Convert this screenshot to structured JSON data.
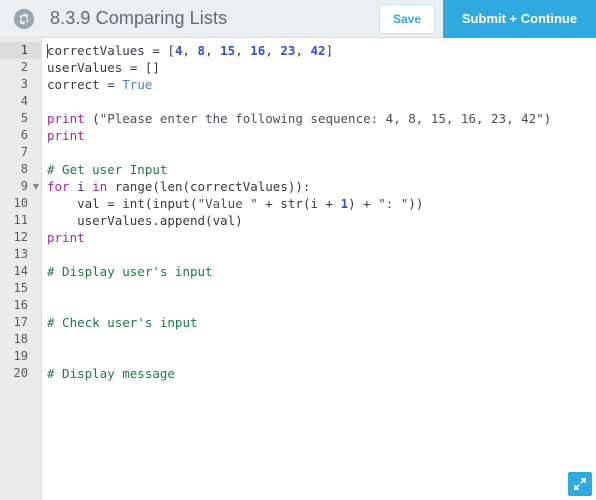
{
  "header": {
    "gear_icon": "gear-icon",
    "title": "8.3.9 Comparing Lists",
    "save_label": "Save",
    "submit_label": "Submit + Continue",
    "accent_color": "#2eaae0",
    "background_color": "#eceff1",
    "title_color": "#5f6a72"
  },
  "editor": {
    "language": "python",
    "active_line": 1,
    "cursor_line": 1,
    "cursor_column": 1,
    "total_lines": 20,
    "fold_lines": [
      9
    ],
    "gutter_color": "#ebebeb",
    "background_color": "#ffffff",
    "syntax_colors": {
      "keyword": "#a626a4",
      "number": "#2f4ed8",
      "constant": "#4a7fe0",
      "string": "#4b4f58",
      "comment": "#1d7a47",
      "plain": "#383a42"
    },
    "lines": [
      {
        "n": "1",
        "tokens": [
          {
            "t": "correctValues ",
            "c": "pln"
          },
          {
            "t": "= ",
            "c": "op"
          },
          {
            "t": "[",
            "c": "pun"
          },
          {
            "t": "4",
            "c": "num"
          },
          {
            "t": ", ",
            "c": "pun"
          },
          {
            "t": "8",
            "c": "num"
          },
          {
            "t": ", ",
            "c": "pun"
          },
          {
            "t": "15",
            "c": "num"
          },
          {
            "t": ", ",
            "c": "pun"
          },
          {
            "t": "16",
            "c": "num"
          },
          {
            "t": ", ",
            "c": "pun"
          },
          {
            "t": "23",
            "c": "num"
          },
          {
            "t": ", ",
            "c": "pun"
          },
          {
            "t": "42",
            "c": "num"
          },
          {
            "t": "]",
            "c": "pun"
          }
        ]
      },
      {
        "n": "2",
        "tokens": [
          {
            "t": "userValues ",
            "c": "pln"
          },
          {
            "t": "= ",
            "c": "op"
          },
          {
            "t": "[]",
            "c": "pun"
          }
        ]
      },
      {
        "n": "3",
        "tokens": [
          {
            "t": "correct ",
            "c": "pln"
          },
          {
            "t": "= ",
            "c": "op"
          },
          {
            "t": "True",
            "c": "const"
          }
        ]
      },
      {
        "n": "4",
        "tokens": []
      },
      {
        "n": "5",
        "tokens": [
          {
            "t": "print",
            "c": "kw"
          },
          {
            "t": " (",
            "c": "pun"
          },
          {
            "t": "\"Please enter the following sequence: 4, 8, 15, 16, 23, 42\"",
            "c": "str"
          },
          {
            "t": ")",
            "c": "pun"
          }
        ]
      },
      {
        "n": "6",
        "tokens": [
          {
            "t": "print",
            "c": "kw"
          }
        ]
      },
      {
        "n": "7",
        "tokens": []
      },
      {
        "n": "8",
        "tokens": [
          {
            "t": "# Get user Input",
            "c": "com"
          }
        ]
      },
      {
        "n": "9",
        "tokens": [
          {
            "t": "for",
            "c": "kw"
          },
          {
            "t": " i ",
            "c": "pln"
          },
          {
            "t": "in",
            "c": "kw"
          },
          {
            "t": " ",
            "c": "pln"
          },
          {
            "t": "range",
            "c": "bi"
          },
          {
            "t": "(",
            "c": "pun"
          },
          {
            "t": "len",
            "c": "bi"
          },
          {
            "t": "(correctValues)):",
            "c": "pun"
          }
        ]
      },
      {
        "n": "10",
        "tokens": [
          {
            "t": "    val ",
            "c": "pln"
          },
          {
            "t": "= ",
            "c": "op"
          },
          {
            "t": "int",
            "c": "bi"
          },
          {
            "t": "(",
            "c": "pun"
          },
          {
            "t": "input",
            "c": "bi"
          },
          {
            "t": "(",
            "c": "pun"
          },
          {
            "t": "\"Value \"",
            "c": "str"
          },
          {
            "t": " + ",
            "c": "op"
          },
          {
            "t": "str",
            "c": "bi"
          },
          {
            "t": "(i ",
            "c": "pun"
          },
          {
            "t": "+ ",
            "c": "op"
          },
          {
            "t": "1",
            "c": "num"
          },
          {
            "t": ")",
            "c": "pun"
          },
          {
            "t": " + ",
            "c": "op"
          },
          {
            "t": "\": \"",
            "c": "str"
          },
          {
            "t": "))",
            "c": "pun"
          }
        ]
      },
      {
        "n": "11",
        "tokens": [
          {
            "t": "    userValues.append(val)",
            "c": "pln"
          }
        ]
      },
      {
        "n": "12",
        "tokens": [
          {
            "t": "print",
            "c": "kw"
          }
        ]
      },
      {
        "n": "13",
        "tokens": []
      },
      {
        "n": "14",
        "tokens": [
          {
            "t": "# Display user's input",
            "c": "com"
          }
        ]
      },
      {
        "n": "15",
        "tokens": []
      },
      {
        "n": "16",
        "tokens": []
      },
      {
        "n": "17",
        "tokens": [
          {
            "t": "# Check user's input",
            "c": "com"
          }
        ]
      },
      {
        "n": "18",
        "tokens": []
      },
      {
        "n": "19",
        "tokens": []
      },
      {
        "n": "20",
        "tokens": [
          {
            "t": "# Display message",
            "c": "com"
          }
        ]
      }
    ]
  },
  "resize": {
    "icon": "resize-diagonal-icon",
    "color": "#2eaae0"
  }
}
